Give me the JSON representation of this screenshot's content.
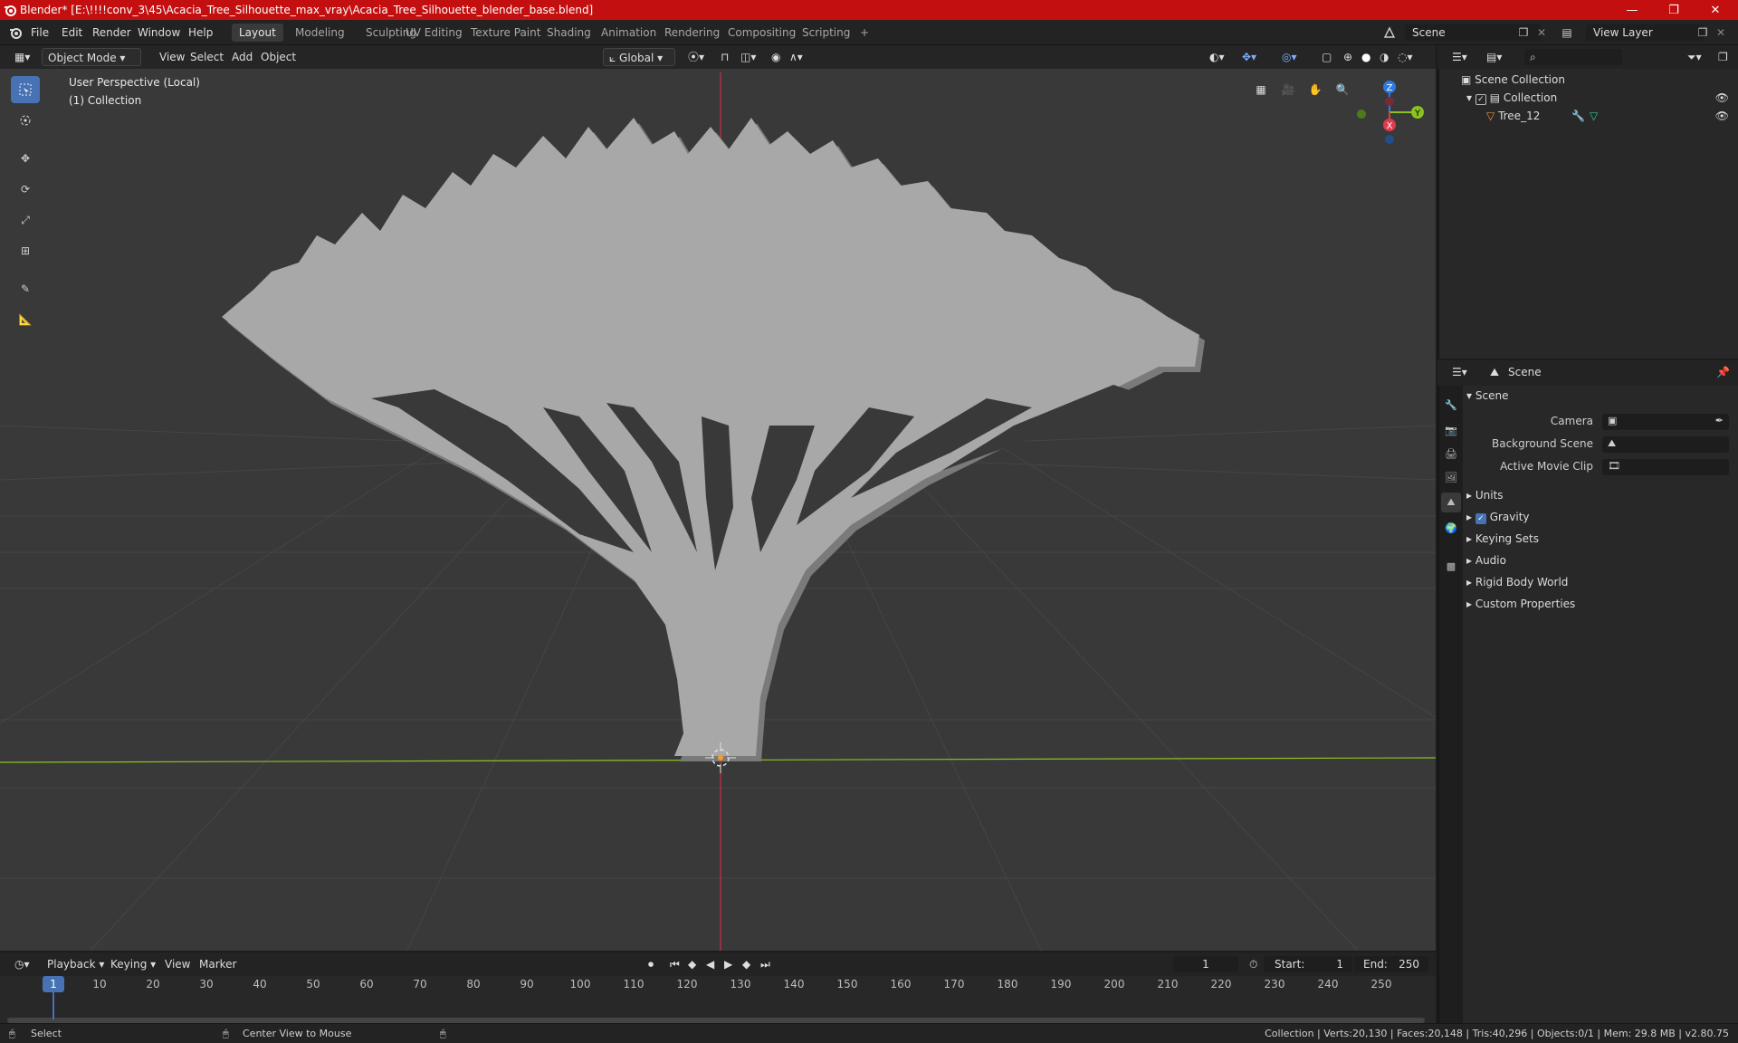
{
  "window": {
    "title": "Blender* [E:\\!!!!conv_3\\45\\Acacia_Tree_Silhouette_max_vray\\Acacia_Tree_Silhouette_blender_base.blend]",
    "minimize": "—",
    "maximize": "❐",
    "close": "✕"
  },
  "menu": [
    "File",
    "Edit",
    "Render",
    "Window",
    "Help"
  ],
  "workspaces": [
    "Layout",
    "Modeling",
    "Sculpting",
    "UV Editing",
    "Texture Paint",
    "Shading",
    "Animation",
    "Rendering",
    "Compositing",
    "Scripting"
  ],
  "workspace_add": "+",
  "scene_field": "Scene",
  "view_layer_field": "View Layer",
  "viewport": {
    "mode": "Object Mode",
    "menus": [
      "View",
      "Select",
      "Add",
      "Object"
    ],
    "transform": "Global",
    "perspective_label": "User Perspective (Local)",
    "collection_label": "(1) Collection",
    "gizmo": {
      "z": "Z",
      "y": "Y",
      "x": "X"
    }
  },
  "outliner": {
    "search_placeholder": "",
    "scene_collection": "Scene Collection",
    "collection": "Collection",
    "object": "Tree_12"
  },
  "properties": {
    "context": "Scene",
    "section": "Scene",
    "camera_label": "Camera",
    "background_scene_label": "Background Scene",
    "active_movie_clip_label": "Active Movie Clip",
    "panels": [
      "Units",
      "Gravity",
      "Keying Sets",
      "Audio",
      "Rigid Body World",
      "Custom Properties"
    ]
  },
  "timeline": {
    "menus": [
      "Playback",
      "Keying",
      "View",
      "Marker"
    ],
    "current_frame": "1",
    "start_label": "Start:",
    "start": "1",
    "end_label": "End:",
    "end": "250",
    "ticks": [
      "10",
      "20",
      "30",
      "40",
      "50",
      "60",
      "70",
      "80",
      "90",
      "100",
      "110",
      "120",
      "130",
      "140",
      "150",
      "160",
      "170",
      "180",
      "190",
      "200",
      "210",
      "220",
      "230",
      "240",
      "250"
    ],
    "playhead": "1"
  },
  "status": {
    "select": "Select",
    "center_view": "Center View to Mouse",
    "stats": "Collection | Verts:20,130 | Faces:20,148 | Tris:40,296 | Objects:0/1 | Mem: 29.8 MB | v2.80.75"
  },
  "colors": {
    "titlebar": "#c30f0f",
    "accent": "#4772b3",
    "axis_x": "#e03a4e",
    "axis_y": "#8ac321",
    "axis_z": "#2d7be0",
    "viewport_bg": "#393939",
    "tree": "#a8a8a8"
  }
}
